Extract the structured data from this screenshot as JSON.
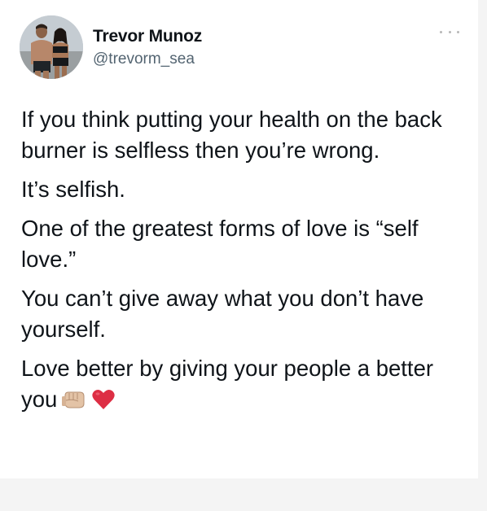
{
  "tweet": {
    "author": {
      "name": "Trevor Munoz",
      "handle": "@trevorm_sea",
      "avatar_icon": "profile-photo"
    },
    "more_icon": "more-options-icon",
    "paragraphs": [
      "If you think putting your health on the back burner is selfless then you’re wrong.",
      "It’s selfish.",
      "One of the greatest forms of love is “self love.”",
      "You can’t give away what you don’t have yourself.",
      "Love better by giving your people a better you"
    ],
    "trailing_emoji": [
      "oncoming-fist-emoji",
      "red-heart-emoji"
    ]
  },
  "colors": {
    "text_primary": "#0f1419",
    "text_secondary": "#536471",
    "card_background": "#ffffff",
    "page_background": "#f4f4f4"
  }
}
